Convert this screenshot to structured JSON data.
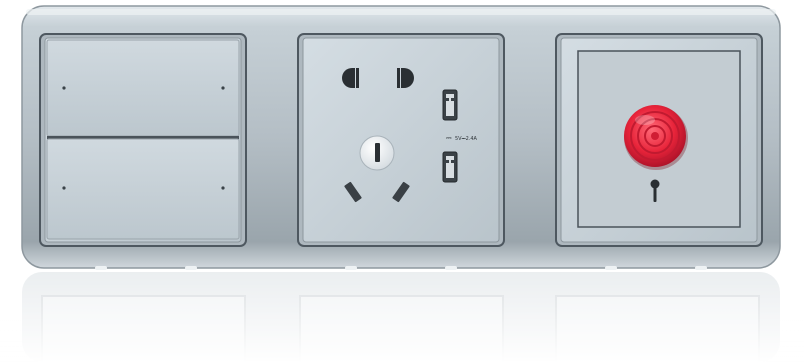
{
  "product": {
    "usb_label": "5V⎓2.4A",
    "usb_rating_icon": "dc-rating-icon",
    "modules": [
      "two-gang-switch",
      "multi-socket-with-usb",
      "emergency-call-button"
    ],
    "emergency_button_color": "#e8243a",
    "frame_color": "#b9c4ca"
  }
}
